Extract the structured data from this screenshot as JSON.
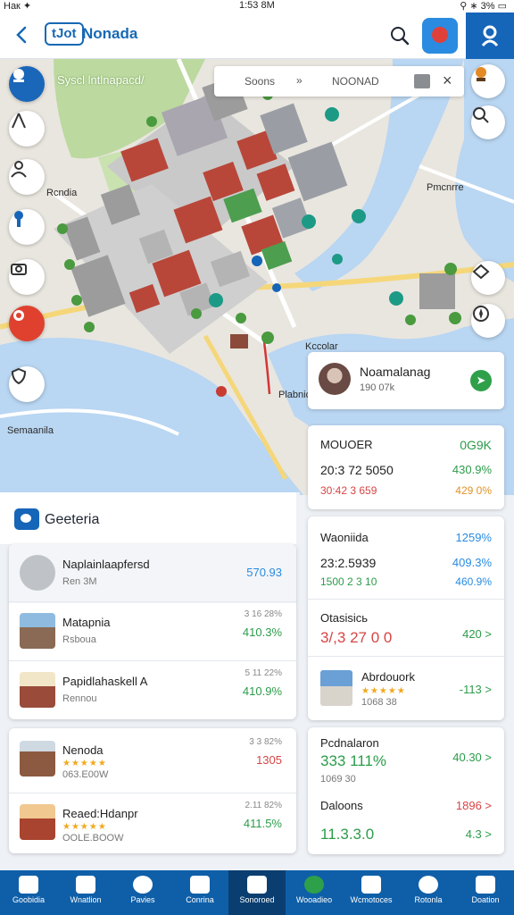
{
  "status": {
    "left": "Hак ✦",
    "center": "1:53 8M",
    "right": "⚲ ∗ 3% ▭"
  },
  "header": {
    "logo": "tJot",
    "title": "Nonada"
  },
  "map": {
    "search": {
      "from": "Soons",
      "arrow": "»",
      "to": "NOONAD"
    },
    "labels": {
      "park": "Syscl lntlnapacd/",
      "west": "Rcndia",
      "east": "Pmcnrre",
      "center": "Kccolar",
      "point": "Plabnic",
      "south": "Semaanila"
    }
  },
  "place_card": {
    "name": "Noamalanag",
    "sub": "190 07k"
  },
  "stats": {
    "s1": {
      "label": "MOUOER",
      "value": "0G9K",
      "line2": "20:3 72 5050",
      "line2_val": "430.9%",
      "line3": "30:42 3 659",
      "line3_val": "429 0%"
    },
    "s2": {
      "label": "Waoniida",
      "value": "1259%",
      "line2": "23:2.5939",
      "line2_val": "409.3%",
      "line3": "1500 2 3 10",
      "line3_val": "460.9%"
    },
    "s3": {
      "label": "Otasisiсь",
      "line2": "3/,3 27 0 0",
      "line2_val": "420 >"
    },
    "s4": {
      "label": "Abrdouork",
      "sub": "1068 38",
      "value": "-113 >"
    },
    "s5": {
      "label": "Pcdnalaron",
      "value": "40.30 >",
      "line2": "333 111%",
      "line3": "1069 30",
      "label2": "Daloons",
      "value2": "1896 >",
      "line4": "11.3.3.0",
      "value4": "4.3 >"
    }
  },
  "panel": {
    "title": "Geeteria",
    "rows": [
      {
        "name": "Naplainlaapfersd",
        "sub": "Ren 3M",
        "v1": "",
        "v2": "570.93"
      },
      {
        "name": "Matapnia",
        "sub": "Rsboua",
        "v1": "3 16 28%",
        "v2": "410.3%"
      },
      {
        "name": "Papidlahaskell A",
        "sub": "Rennou",
        "v1": "5 11 22%",
        "v2": "410.9%"
      },
      {
        "name": "Nenoda",
        "sub": "063.E00W",
        "v1": "3 3 82%",
        "v2": "1305"
      },
      {
        "name": "Reaed:Hdanpr",
        "sub": "OOLE.BOOW",
        "v1": "2.11 82%",
        "v2": "411.5%"
      }
    ]
  },
  "nav": {
    "items": [
      {
        "label": "Goobidia"
      },
      {
        "label": "Wnatlion"
      },
      {
        "label": "Pavies"
      },
      {
        "label": "Conrina"
      },
      {
        "label": "Sonoroed"
      },
      {
        "label": "Wooadieo"
      },
      {
        "label": "Wcmotoces"
      },
      {
        "label": "Rotonla"
      },
      {
        "label": "Doation"
      }
    ]
  }
}
